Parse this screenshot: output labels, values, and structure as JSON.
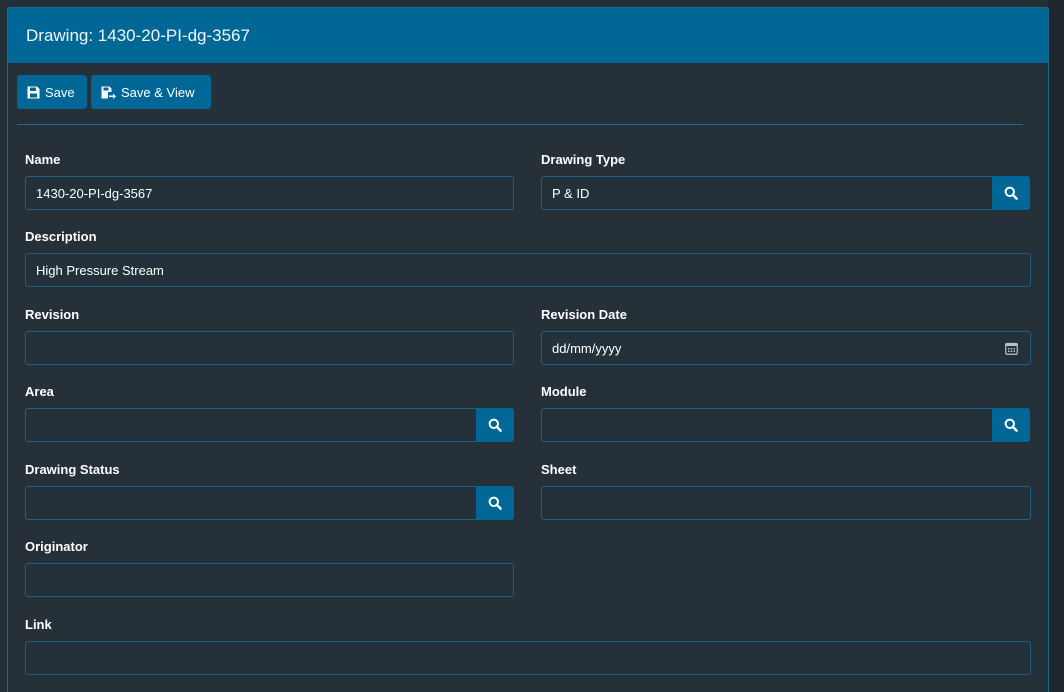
{
  "panel": {
    "title": "Drawing: 1430-20-PI-dg-3567"
  },
  "toolbar": {
    "save_label": "Save",
    "save_view_label": "Save & View"
  },
  "fields": {
    "name": {
      "label": "Name",
      "value": "1430-20-PI-dg-3567"
    },
    "drawing_type": {
      "label": "Drawing Type",
      "value": "P & ID"
    },
    "description": {
      "label": "Description",
      "value": "High Pressure Stream"
    },
    "revision": {
      "label": "Revision",
      "value": ""
    },
    "revision_date": {
      "label": "Revision Date",
      "value": "dd/mm/yyyy"
    },
    "area": {
      "label": "Area",
      "value": ""
    },
    "module": {
      "label": "Module",
      "value": ""
    },
    "drawing_status": {
      "label": "Drawing Status",
      "value": ""
    },
    "sheet": {
      "label": "Sheet",
      "value": ""
    },
    "originator": {
      "label": "Originator",
      "value": ""
    },
    "link": {
      "label": "Link",
      "value": ""
    }
  },
  "icons": {
    "save": "floppy-disk-icon",
    "save_view": "save-and-view-icon",
    "search": "search-icon",
    "calendar": "calendar-icon"
  },
  "colors": {
    "accent": "#006796",
    "background": "#252f37",
    "border": "#1e5f84"
  }
}
